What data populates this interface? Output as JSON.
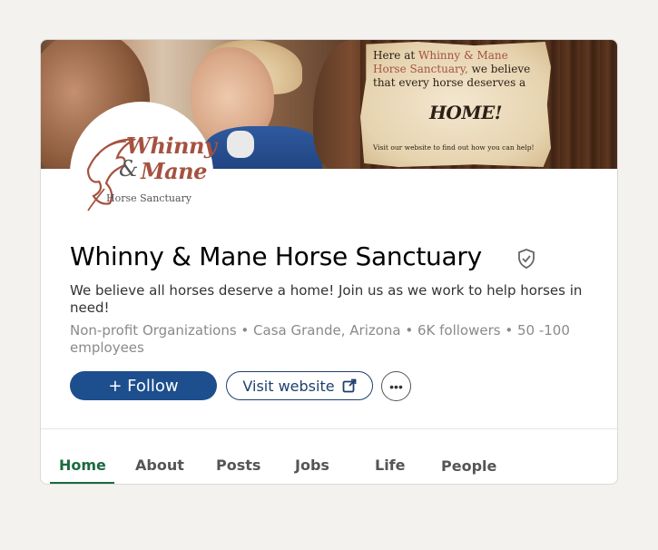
{
  "banner": {
    "line1_prefix": "Here at ",
    "line1_accent": "Whinny & Mane",
    "line2_accent": "Horse Sanctuary,",
    "line2_suffix": " we believe",
    "line3": "that every horse deserves a",
    "home": "HOME!",
    "small": "Visit our website to find out how you can help!"
  },
  "logo": {
    "whinny": "Whinny",
    "amp": "&",
    "mane": "Mane",
    "sub": "Horse Sanctuary"
  },
  "company": {
    "name": "Whinny & Mane Horse Sanctuary",
    "tagline": "We believe all horses deserve a home! Join us as we work to help horses in need!",
    "meta": "Non-profit Organizations • Casa Grande, Arizona • 6K followers • 50 -100 employees"
  },
  "actions": {
    "follow": "+ Follow",
    "visit": "Visit website",
    "more": "•••"
  },
  "tabs": [
    {
      "label": "Home",
      "active": true
    },
    {
      "label": "About"
    },
    {
      "label": "Posts"
    },
    {
      "label": "Jobs"
    },
    {
      "label": "Life"
    },
    {
      "label": "People"
    }
  ],
  "colors": {
    "brand_blue": "#1d4e8d",
    "active_tab_green": "#1a6b3f",
    "logo_accent": "#a4523f"
  },
  "icons": {
    "verified": "shield-check-icon",
    "external_link": "external-link-icon",
    "more": "more-horizontal-icon"
  }
}
